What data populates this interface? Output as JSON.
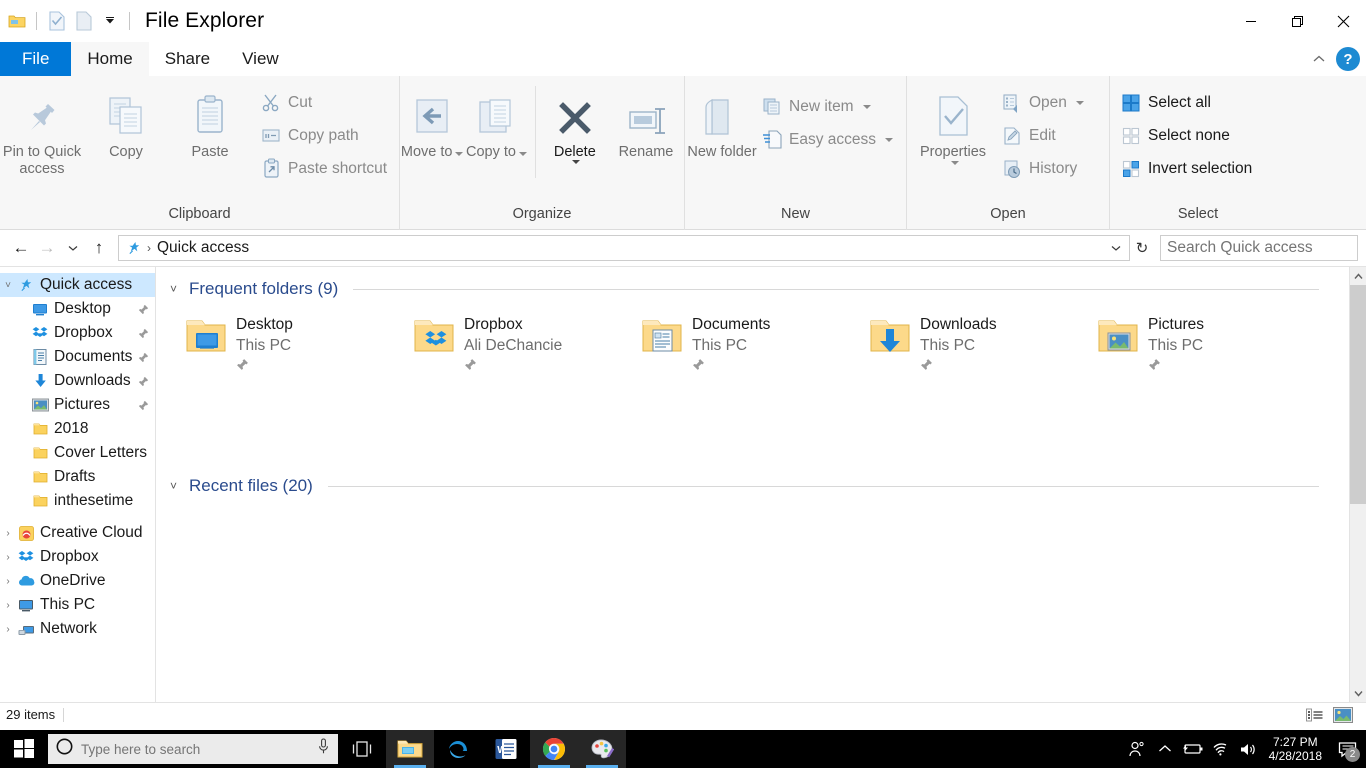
{
  "window": {
    "title": "File Explorer",
    "qat_icons": [
      "folder-icon",
      "properties-check-icon",
      "new-folder-icon",
      "customize-qat-chevron-icon"
    ],
    "controls": {
      "minimize": "–",
      "restore": "❐",
      "close": "✕"
    }
  },
  "tabs": [
    {
      "label": "File",
      "id": "file"
    },
    {
      "label": "Home",
      "id": "home"
    },
    {
      "label": "Share",
      "id": "share"
    },
    {
      "label": "View",
      "id": "view"
    }
  ],
  "tab_right": {
    "collapse": "collapse-ribbon-icon",
    "help": "?"
  },
  "ribbon": {
    "groups": [
      {
        "label": "Clipboard",
        "big": [
          {
            "label": "Pin to Quick\naccess",
            "icon": "pin-icon",
            "enabled": false
          },
          {
            "label": "Copy",
            "icon": "copy-icon",
            "enabled": false
          },
          {
            "label": "Paste",
            "icon": "paste-icon",
            "enabled": false
          }
        ],
        "small": [
          {
            "label": "Cut",
            "icon": "scissors-icon",
            "enabled": false
          },
          {
            "label": "Copy path",
            "icon": "copy-path-icon",
            "enabled": false
          },
          {
            "label": "Paste shortcut",
            "icon": "paste-shortcut-icon",
            "enabled": false
          }
        ]
      },
      {
        "label": "Organize",
        "big": [
          {
            "label": "Move\nto",
            "icon": "move-to-icon",
            "enabled": false,
            "dropdown": true
          },
          {
            "label": "Copy\nto",
            "icon": "copy-to-icon",
            "enabled": false,
            "dropdown": true
          },
          {
            "label": "Delete",
            "icon": "delete-x-icon",
            "enabled": true,
            "dropdown": true
          },
          {
            "label": "Rename",
            "icon": "rename-icon",
            "enabled": false
          }
        ],
        "small": []
      },
      {
        "label": "New",
        "big": [
          {
            "label": "New\nfolder",
            "icon": "new-folder-icon",
            "enabled": false
          }
        ],
        "small": [
          {
            "label": "New item",
            "icon": "new-item-icon",
            "enabled": false,
            "dropdown": true
          },
          {
            "label": "Easy access",
            "icon": "easy-access-icon",
            "enabled": false,
            "dropdown": true
          }
        ]
      },
      {
        "label": "Open",
        "big": [
          {
            "label": "Properties",
            "icon": "properties-icon",
            "enabled": false,
            "dropdown": true
          }
        ],
        "small": [
          {
            "label": "Open",
            "icon": "open-icon",
            "enabled": false,
            "dropdown": true
          },
          {
            "label": "Edit",
            "icon": "edit-icon",
            "enabled": false
          },
          {
            "label": "History",
            "icon": "history-icon",
            "enabled": false
          }
        ]
      },
      {
        "label": "Select",
        "big": [],
        "small": [
          {
            "label": "Select all",
            "icon": "select-all-icon",
            "enabled": true
          },
          {
            "label": "Select none",
            "icon": "select-none-icon",
            "enabled": true
          },
          {
            "label": "Invert selection",
            "icon": "invert-selection-icon",
            "enabled": true
          }
        ]
      }
    ]
  },
  "addressbar": {
    "back": "←",
    "forward": "→",
    "recent": "recent-locations-chevron-icon",
    "up": "↑",
    "crumb_icon": "quick-access-star-icon",
    "crumb": "Quick access",
    "dropdown": "address-dropdown-icon",
    "refresh": "↻",
    "search_placeholder": "Search Quick access",
    "search_value": ""
  },
  "nav": {
    "items": [
      {
        "label": "Quick access",
        "icon": "quick-access-star-icon",
        "expander": "˅",
        "selected": true,
        "indent": false,
        "pinned": false
      },
      {
        "label": "Desktop",
        "icon": "desktop-icon",
        "expander": "",
        "selected": false,
        "indent": true,
        "pinned": true
      },
      {
        "label": "Dropbox",
        "icon": "dropbox-icon",
        "expander": "",
        "selected": false,
        "indent": true,
        "pinned": true
      },
      {
        "label": "Documents",
        "icon": "documents-icon",
        "expander": "",
        "selected": false,
        "indent": true,
        "pinned": true
      },
      {
        "label": "Downloads",
        "icon": "downloads-icon",
        "expander": "",
        "selected": false,
        "indent": true,
        "pinned": true
      },
      {
        "label": "Pictures",
        "icon": "pictures-icon",
        "expander": "",
        "selected": false,
        "indent": true,
        "pinned": true
      },
      {
        "label": "2018",
        "icon": "folder-icon",
        "expander": "",
        "selected": false,
        "indent": true,
        "pinned": false
      },
      {
        "label": "Cover Letters",
        "icon": "folder-icon",
        "expander": "",
        "selected": false,
        "indent": true,
        "pinned": false
      },
      {
        "label": "Drafts",
        "icon": "folder-icon",
        "expander": "",
        "selected": false,
        "indent": true,
        "pinned": false
      },
      {
        "label": "inthesetime",
        "icon": "folder-icon",
        "expander": "",
        "selected": false,
        "indent": true,
        "pinned": false
      },
      {
        "label": "Creative Cloud",
        "icon": "creative-cloud-icon",
        "expander": "›",
        "selected": false,
        "indent": false,
        "pinned": false
      },
      {
        "label": "Dropbox",
        "icon": "dropbox-icon",
        "expander": "›",
        "selected": false,
        "indent": false,
        "pinned": false
      },
      {
        "label": "OneDrive",
        "icon": "onedrive-icon",
        "expander": "›",
        "selected": false,
        "indent": false,
        "pinned": false
      },
      {
        "label": "This PC",
        "icon": "this-pc-icon",
        "expander": "›",
        "selected": false,
        "indent": false,
        "pinned": false
      },
      {
        "label": "Network",
        "icon": "network-icon",
        "expander": "›",
        "selected": false,
        "indent": false,
        "pinned": false
      }
    ]
  },
  "content": {
    "sections": [
      {
        "title": "Frequent folders (9)",
        "chevron": "˅"
      },
      {
        "title": "Recent files (20)",
        "chevron": "˅"
      }
    ],
    "frequent_folders": [
      {
        "name": "Desktop",
        "sub": "This PC",
        "icon": "desktop-folder-icon",
        "pinned": true
      },
      {
        "name": "Dropbox",
        "sub": "Ali DeChancie",
        "icon": "dropbox-folder-icon",
        "pinned": true
      },
      {
        "name": "Documents",
        "sub": "This PC",
        "icon": "documents-folder-icon",
        "pinned": true
      },
      {
        "name": "Downloads",
        "sub": "This PC",
        "icon": "downloads-folder-icon",
        "pinned": true
      },
      {
        "name": "Pictures",
        "sub": "This PC",
        "icon": "pictures-folder-icon",
        "pinned": true
      }
    ]
  },
  "status": {
    "items_text": "29 items",
    "view_buttons": [
      {
        "name": "details-view-button",
        "icon": "details-view-icon",
        "active": false
      },
      {
        "name": "large-icons-view-button",
        "icon": "large-icons-view-icon",
        "active": true
      }
    ]
  },
  "taskbar": {
    "start": "windows-logo-icon",
    "search_placeholder": "Type here to search",
    "search_value": "",
    "mic": "microphone-icon",
    "task_view": "task-view-icon",
    "apps": [
      {
        "name": "file-explorer-taskbar-button",
        "icon": "file-explorer-icon",
        "active": true
      },
      {
        "name": "edge-taskbar-button",
        "icon": "edge-icon",
        "active": false
      },
      {
        "name": "word-taskbar-button",
        "icon": "word-icon",
        "active": false
      },
      {
        "name": "chrome-taskbar-button",
        "icon": "chrome-icon",
        "active": true
      },
      {
        "name": "paint3d-taskbar-button",
        "icon": "paint3d-icon",
        "active": true
      }
    ],
    "tray": [
      {
        "name": "people-icon"
      },
      {
        "name": "show-hidden-icons-icon"
      },
      {
        "name": "battery-icon"
      },
      {
        "name": "wifi-icon"
      },
      {
        "name": "volume-icon"
      }
    ],
    "time": "7:27 PM",
    "date": "4/28/2018",
    "notification_count": "2"
  },
  "colors": {
    "accent": "#0078d7",
    "selection": "#cde8ff",
    "section_title": "#2a4b8d",
    "folder": "#fcd462",
    "ribbon_bg": "#f7f7f7"
  }
}
